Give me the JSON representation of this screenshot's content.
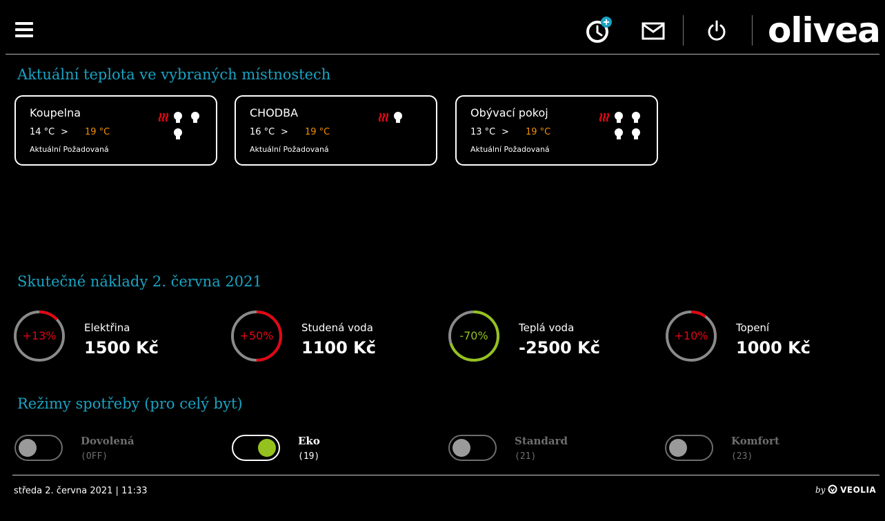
{
  "header": {
    "brand": "olivea",
    "icons": [
      "menu-icon",
      "clock-plus-icon",
      "mail-icon",
      "power-icon"
    ]
  },
  "rooms_section": {
    "title": "Aktuální teplota ve vybraných místnostech",
    "rooms": [
      {
        "name": "Koupelna",
        "current": "14 °C",
        "arrow": ">",
        "required": "19 °C",
        "label_current": "Aktuální",
        "label_required": "Požadovaná",
        "heater_icon": "heater-icon",
        "bulbs": 3
      },
      {
        "name": "CHODBA",
        "current": "16 °C",
        "arrow": ">",
        "required": "19 °C",
        "label_current": "Aktuální",
        "label_required": "Požadovaná",
        "heater_icon": "heater-icon",
        "bulbs": 1
      },
      {
        "name": "Obývací pokoj",
        "current": "13 °C",
        "arrow": ">",
        "required": "19 °C",
        "label_current": "Aktuální",
        "label_required": "Požadovaná",
        "heater_icon": "heater-icon",
        "bulbs": 4
      }
    ]
  },
  "costs_section": {
    "title": "Skutečné náklady 2. června 2021",
    "items": [
      {
        "name": "Elektřina",
        "percent": "+13%",
        "value": "1500 Kč",
        "ring_fraction": 0.13,
        "color": "#e30613"
      },
      {
        "name": "Studená voda",
        "percent": "+50%",
        "value": "1100 Kč",
        "ring_fraction": 0.5,
        "color": "#e30613"
      },
      {
        "name": "Teplá voda",
        "percent": "-70%",
        "value": "-2500 Kč",
        "ring_fraction": 0.7,
        "color": "#95c11f"
      },
      {
        "name": "Topení",
        "percent": "+10%",
        "value": "1000 Kč",
        "ring_fraction": 0.1,
        "color": "#e30613"
      }
    ]
  },
  "modes_section": {
    "title": "Režimy spotřeby (pro celý byt)",
    "modes": [
      {
        "name": "Dovolená",
        "sub": "(OFF)",
        "active": false
      },
      {
        "name": "Eko",
        "sub": "(19)",
        "active": true
      },
      {
        "name": "Standard",
        "sub": "(21)",
        "active": false
      },
      {
        "name": "Komfort",
        "sub": "(23)",
        "active": false
      }
    ]
  },
  "footer": {
    "date": "středa 2. června 2021 | 11:33",
    "by": "by",
    "brand": "VEOLIA"
  },
  "colors": {
    "accent": "#1aa3c4",
    "orange": "#f39200",
    "red": "#e30613",
    "green": "#95c11f",
    "gray": "#6e6e6e"
  }
}
